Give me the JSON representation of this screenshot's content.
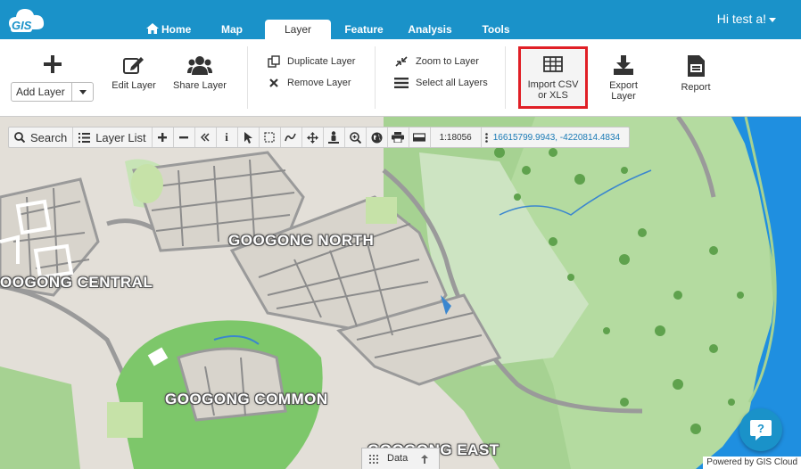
{
  "nav": {
    "logo_text": "GIS",
    "tabs": [
      {
        "label": "Home",
        "active": false
      },
      {
        "label": "Map",
        "active": false
      },
      {
        "label": "Layer",
        "active": true
      },
      {
        "label": "Feature",
        "active": false
      },
      {
        "label": "Analysis",
        "active": false
      },
      {
        "label": "Tools",
        "active": false
      }
    ],
    "user_greeting": "Hi test a!"
  },
  "ribbon": {
    "add_layer": "Add Layer",
    "edit_layer": "Edit Layer",
    "share_layer": "Share Layer",
    "duplicate_layer": "Duplicate Layer",
    "remove_layer": "Remove Layer",
    "zoom_to_layer": "Zoom to Layer",
    "select_all_layers": "Select all Layers",
    "import_csv_line1": "Import CSV",
    "import_csv_line2": "or XLS",
    "export_layer_line1": "Export",
    "export_layer_line2": "Layer",
    "report": "Report"
  },
  "map_toolbar": {
    "search": "Search",
    "layer_list": "Layer List",
    "info_glyph": "i",
    "scale": "1:18056",
    "coordinates": "16615799.9943, -4220814.4834"
  },
  "map_labels": {
    "north": "GOOGONG NORTH",
    "central": "OOGONG CENTRAL",
    "common": "GOOGONG COMMON",
    "east": "GOOGONG EAST"
  },
  "footer": {
    "data_tab": "Data",
    "powered_by": "Powered by GIS Cloud"
  },
  "colors": {
    "brand": "#1a92c9",
    "highlight": "#e01f26",
    "park": "#7dc76a",
    "water": "#1f8fe0"
  }
}
